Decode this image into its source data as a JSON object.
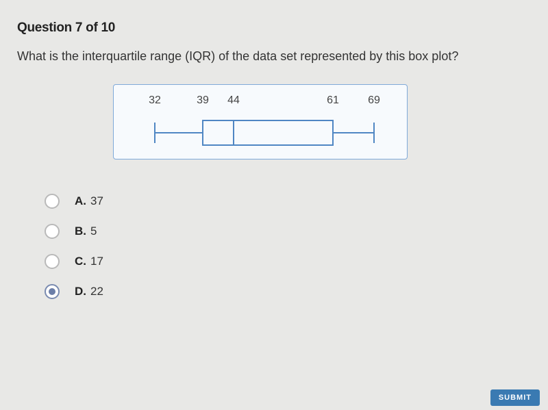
{
  "question": {
    "header": "Question 7 of 10",
    "text": "What is the interquartile range (IQR) of the data set represented by this box plot?"
  },
  "chart_data": {
    "type": "boxplot",
    "min": 32,
    "q1": 39,
    "median": 44,
    "q3": 61,
    "max": 69,
    "labels": [
      "32",
      "39",
      "44",
      "61",
      "69"
    ]
  },
  "answers": [
    {
      "letter": "A.",
      "value": "37",
      "selected": false
    },
    {
      "letter": "B.",
      "value": "5",
      "selected": false
    },
    {
      "letter": "C.",
      "value": "17",
      "selected": false
    },
    {
      "letter": "D.",
      "value": "22",
      "selected": true
    }
  ],
  "submit_label": "SUBMIT"
}
